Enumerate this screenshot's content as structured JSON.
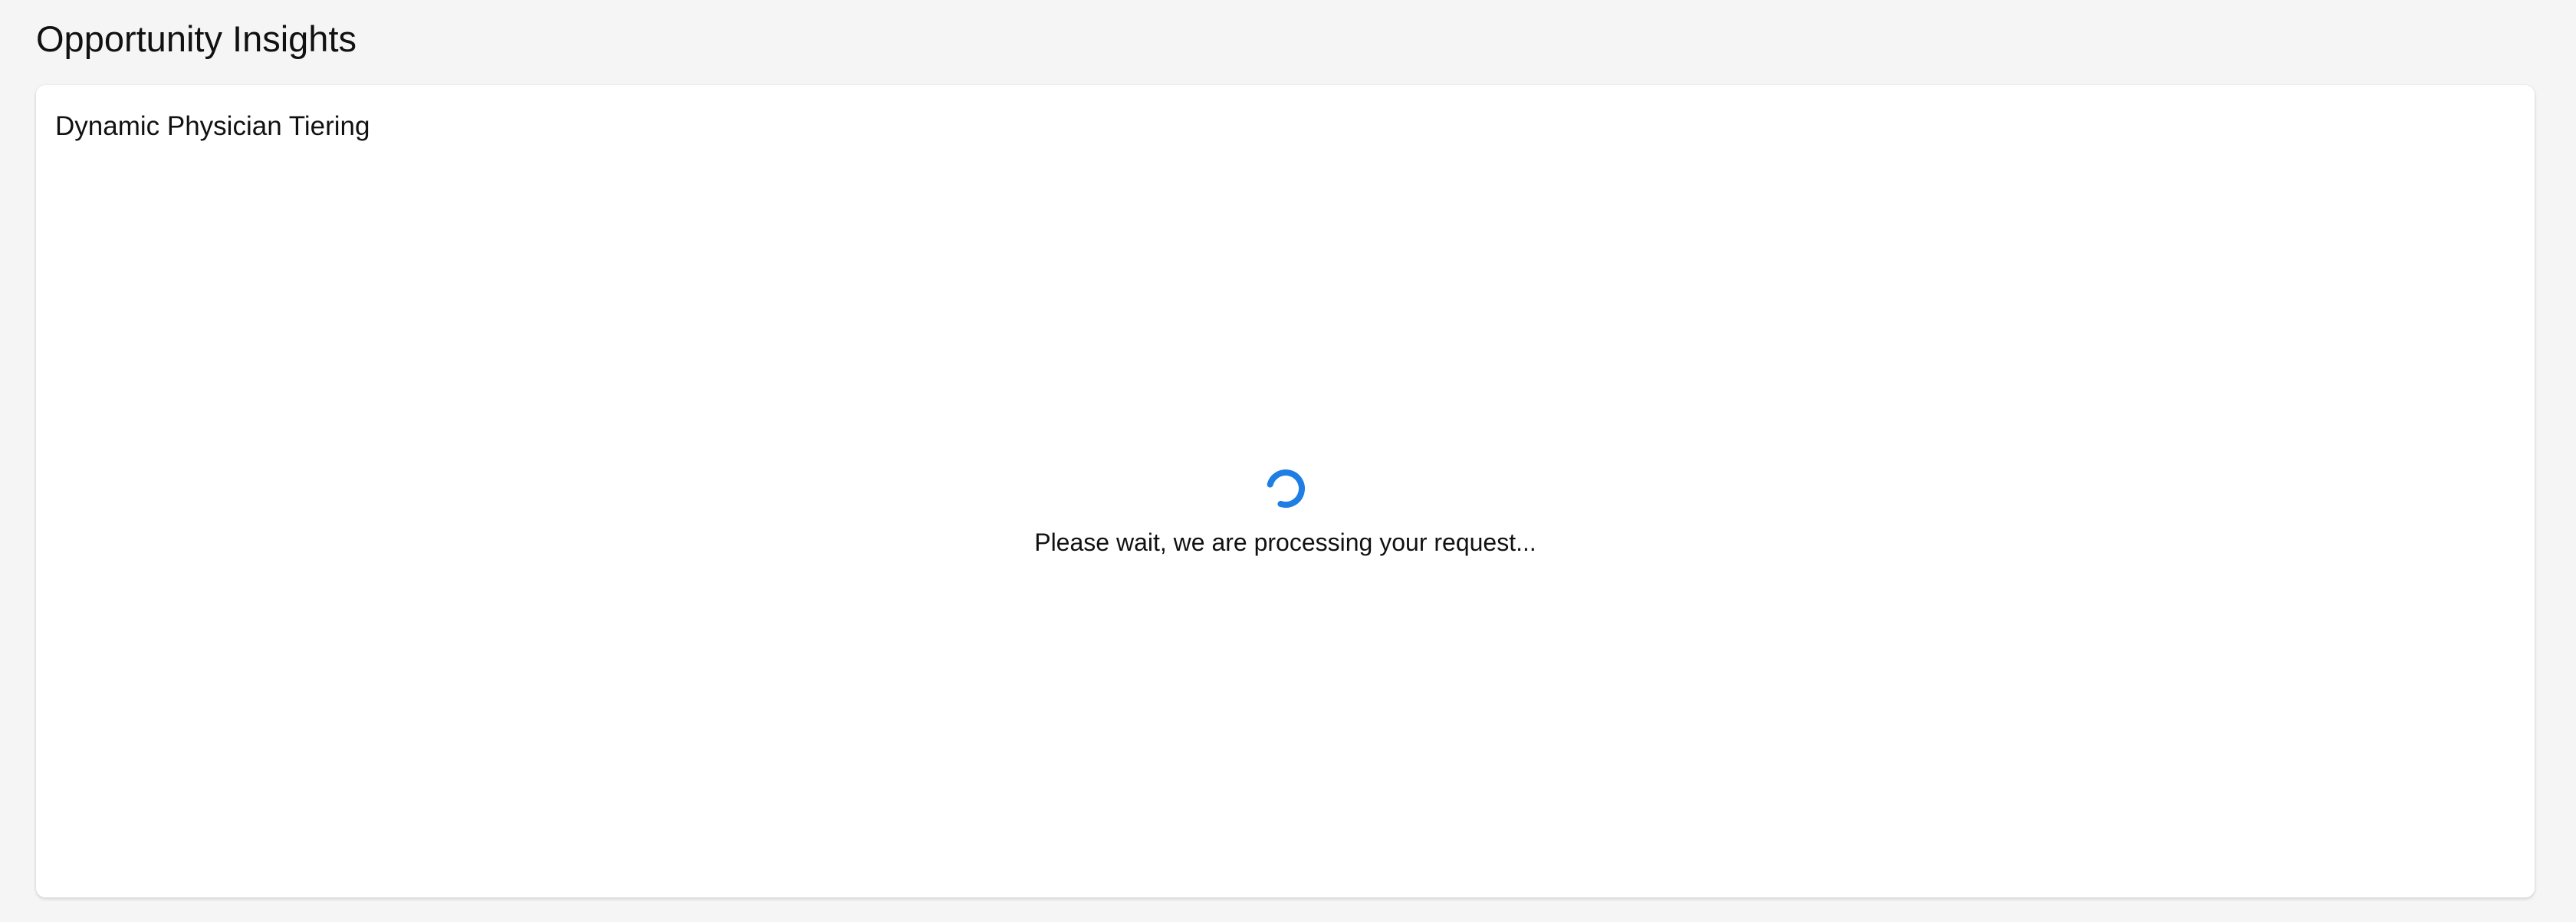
{
  "page": {
    "title": "Opportunity Insights"
  },
  "card": {
    "title": "Dynamic Physician Tiering",
    "loading": {
      "icon": "loading-spinner-icon",
      "message": "Please wait, we are processing your request...",
      "accent_color": "#1e7ee4"
    }
  }
}
